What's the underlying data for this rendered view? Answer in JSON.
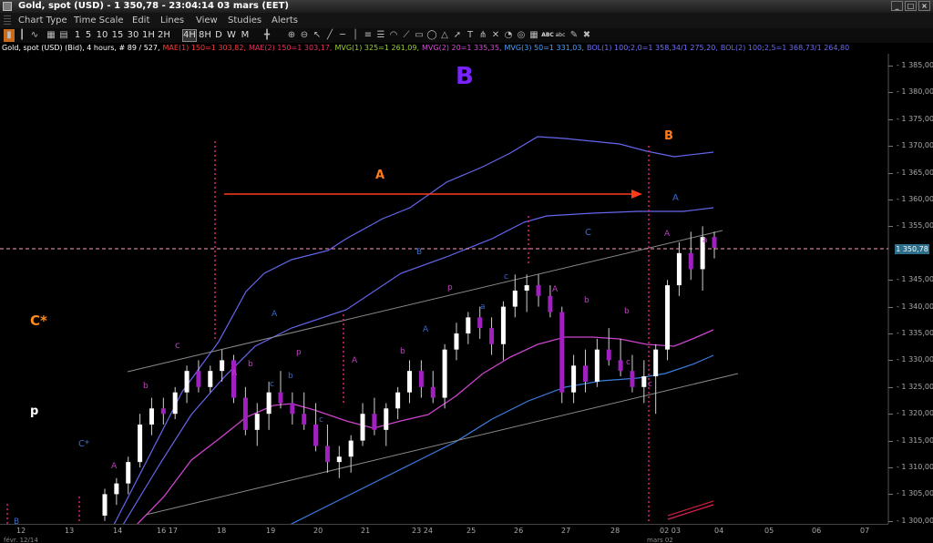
{
  "titlebar": {
    "text": "Gold, spot (USD) - 1 350,78 - 23:04:14 03 mars (EET)"
  },
  "menu": [
    "Chart Type",
    "Time Scale",
    "Edit",
    "Lines",
    "View",
    "Studies",
    "Alerts"
  ],
  "toolbar": {
    "timeframes": [
      "1",
      "5",
      "10",
      "15",
      "30",
      "1H",
      "2H",
      "4H",
      "8H",
      "D",
      "W",
      "M"
    ],
    "active_timeframe": "4H",
    "tool_labels": [
      "ABC",
      "abc"
    ]
  },
  "indicators": [
    {
      "text": "Gold, spot (USD) (Bid), 4 hours, # 89 / 527,",
      "color": "#ffffff"
    },
    {
      "text": "MAE(1) 150=1 303,82,",
      "color": "#ff3b3b"
    },
    {
      "text": "MAE(2) 150=1 303,17,",
      "color": "#e63060"
    },
    {
      "text": "MVG(1) 325=1 261,09,",
      "color": "#9ad23a"
    },
    {
      "text": "MVG(2) 20=1 335,35,",
      "color": "#d050d0"
    },
    {
      "text": "MVG(3) 50=1 331,03,",
      "color": "#4aa0ff"
    },
    {
      "text": "BOL(1) 100;2,0=1 358,34/1 275,20,",
      "color": "#7070ff"
    },
    {
      "text": "BOL(2) 100;2,5=1 368,73/1 264,80",
      "color": "#6a6aee"
    }
  ],
  "price_axis": {
    "ticks": [
      "1 385,00",
      "1 380,00",
      "1 375,00",
      "1 370,00",
      "1 365,00",
      "1 360,00",
      "1 355,00",
      "1 345,00",
      "1 340,00",
      "1 335,00",
      "1 330,00",
      "1 325,00",
      "1 320,00",
      "1 315,00",
      "1 310,00",
      "1 305,00",
      "1 300,00"
    ],
    "last_price": "1 350,78"
  },
  "time_axis": {
    "ticks": [
      "12",
      "13",
      "14",
      "16 17",
      "18",
      "19",
      "20",
      "21",
      "23 24",
      "25",
      "26",
      "27",
      "28",
      "02 03",
      "04",
      "05",
      "06",
      "07"
    ],
    "sub_left": "févr. 12/14",
    "sub_right": "mars 02"
  },
  "annotations": {
    "big_B": "B",
    "orange_A": "A",
    "orange_B": "B",
    "c_star": "C*",
    "p_white": "p",
    "blue_c_star": "C*",
    "b1": "B",
    "wave_labels": [
      "A",
      "b",
      "c",
      "A",
      "b",
      "c",
      "A",
      "b",
      "p",
      "A",
      "b",
      "c",
      "A",
      "B",
      "A",
      "b",
      "p",
      "a",
      "c",
      "A",
      "b",
      "c",
      "A",
      "C",
      "a",
      "c"
    ]
  },
  "colors": {
    "background": "#000000",
    "bollinger": "#6a6aee",
    "ma_magenta": "#d050d0",
    "ma_blue": "#3a7fe0",
    "bull_candle": "#ffffff",
    "bear_candle": "#a020c0",
    "annotation_orange": "#ff7a1a",
    "annotation_purple": "#7a22ff"
  },
  "chart_data": {
    "type": "candlestick",
    "symbol": "Gold, spot (USD) (Bid)",
    "timeframe": "4 hours",
    "ylim": [
      1300,
      1387
    ],
    "last_price": 1350.78,
    "candles": [
      [
        1301,
        1306,
        1300,
        1305
      ],
      [
        1305,
        1308,
        1303,
        1307
      ],
      [
        1307,
        1312,
        1305,
        1311
      ],
      [
        1311,
        1320,
        1310,
        1318
      ],
      [
        1318,
        1323,
        1316,
        1321
      ],
      [
        1321,
        1323,
        1318,
        1320
      ],
      [
        1320,
        1325,
        1319,
        1324
      ],
      [
        1324,
        1329,
        1322,
        1328
      ],
      [
        1328,
        1330,
        1324,
        1325
      ],
      [
        1325,
        1329,
        1324,
        1328
      ],
      [
        1328,
        1332,
        1326,
        1330
      ],
      [
        1330,
        1331,
        1322,
        1323
      ],
      [
        1323,
        1325,
        1316,
        1317
      ],
      [
        1317,
        1322,
        1314,
        1320
      ],
      [
        1320,
        1326,
        1317,
        1324
      ],
      [
        1324,
        1328,
        1321,
        1322
      ],
      [
        1322,
        1324,
        1318,
        1320
      ],
      [
        1320,
        1324,
        1317,
        1318
      ],
      [
        1318,
        1322,
        1313,
        1314
      ],
      [
        1314,
        1318,
        1309,
        1311
      ],
      [
        1311,
        1314,
        1308,
        1312
      ],
      [
        1312,
        1316,
        1309,
        1315
      ],
      [
        1315,
        1322,
        1314,
        1320
      ],
      [
        1320,
        1323,
        1316,
        1317
      ],
      [
        1317,
        1322,
        1314,
        1321
      ],
      [
        1321,
        1325,
        1319,
        1324
      ],
      [
        1324,
        1330,
        1322,
        1328
      ],
      [
        1328,
        1330,
        1323,
        1325
      ],
      [
        1325,
        1328,
        1322,
        1323
      ],
      [
        1323,
        1333,
        1321,
        1332
      ],
      [
        1332,
        1337,
        1330,
        1335
      ],
      [
        1335,
        1339,
        1333,
        1338
      ],
      [
        1338,
        1340,
        1334,
        1336
      ],
      [
        1336,
        1338,
        1331,
        1333
      ],
      [
        1333,
        1341,
        1330,
        1340
      ],
      [
        1340,
        1346,
        1338,
        1343
      ],
      [
        1343,
        1346,
        1339,
        1344
      ],
      [
        1344,
        1346,
        1340,
        1342
      ],
      [
        1342,
        1344,
        1338,
        1339
      ],
      [
        1339,
        1340,
        1322,
        1324
      ],
      [
        1324,
        1331,
        1322,
        1329
      ],
      [
        1329,
        1332,
        1324,
        1326
      ],
      [
        1326,
        1334,
        1325,
        1332
      ],
      [
        1332,
        1336,
        1329,
        1330
      ],
      [
        1330,
        1334,
        1327,
        1328
      ],
      [
        1328,
        1331,
        1324,
        1325
      ],
      [
        1325,
        1330,
        1322,
        1327
      ],
      [
        1327,
        1333,
        1320,
        1332
      ],
      [
        1332,
        1345,
        1330,
        1344
      ],
      [
        1344,
        1352,
        1342,
        1350
      ],
      [
        1350,
        1354,
        1345,
        1347
      ],
      [
        1347,
        1355,
        1343,
        1353
      ],
      [
        1353,
        1354,
        1349,
        1351
      ]
    ],
    "trend_lines": [
      {
        "name": "upper channel",
        "from": [
          1329,
          5
        ],
        "to": [
          1354,
          60
        ]
      },
      {
        "name": "lower channel",
        "from": [
          1302,
          5
        ],
        "to": [
          1327,
          63
        ]
      }
    ],
    "grid": false
  }
}
